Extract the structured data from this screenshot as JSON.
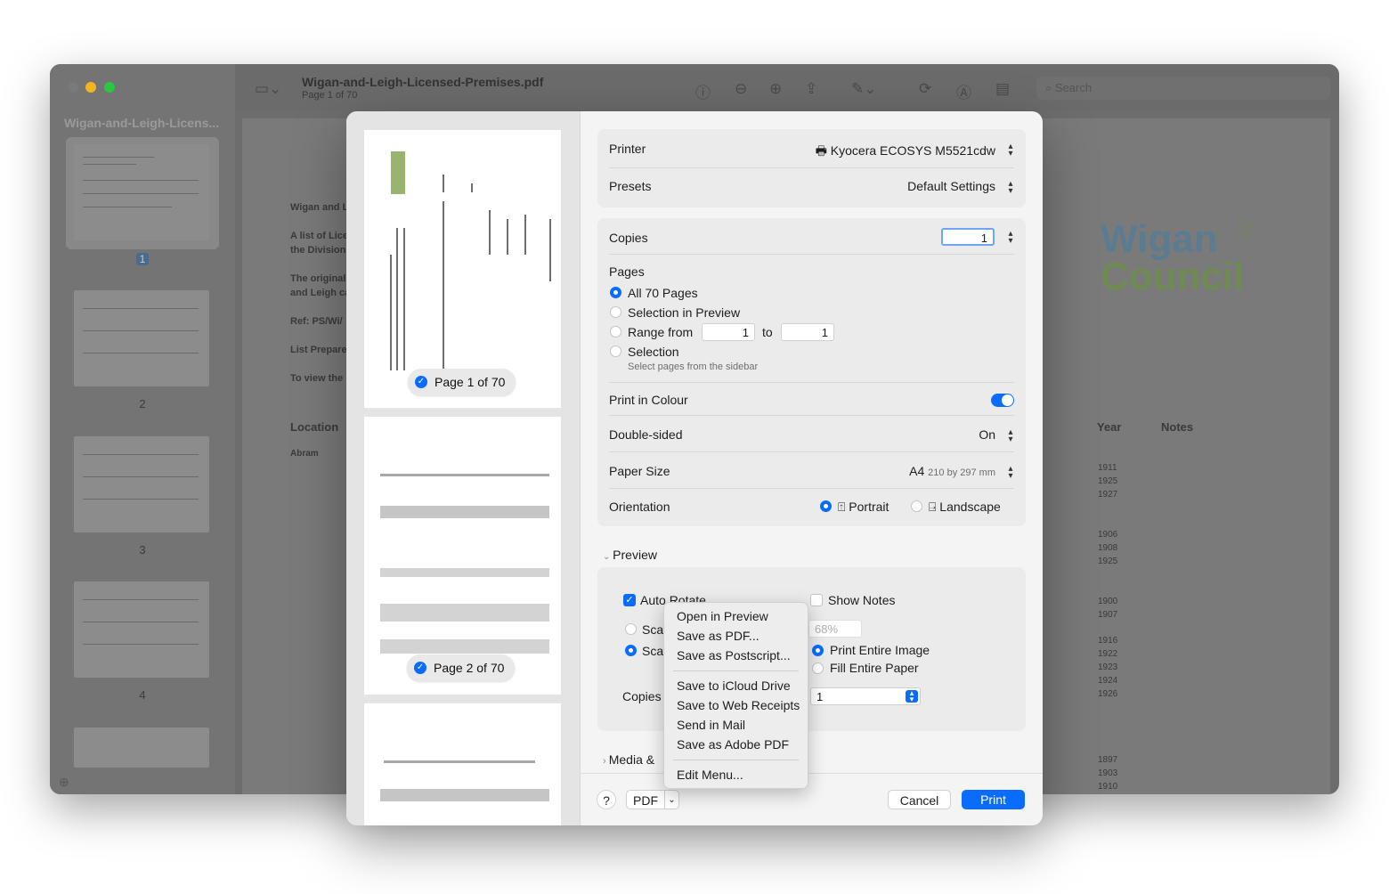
{
  "window": {
    "doc_title": "Wigan-and-Leigh-Licensed-Premises.pdf",
    "doc_subtitle": "Page 1 of 70",
    "search_placeholder": "Search",
    "sidebar_title": "Wigan-and-Leigh-Licens...",
    "thumbnail_numbers": [
      "1",
      "2",
      "3",
      "4"
    ]
  },
  "document": {
    "lines": [
      "Wigan and L",
      "A list of Lice",
      "the Division",
      "The original",
      "and Leigh ca",
      "Ref: PS/Wi/",
      "List Prepare",
      "To view the"
    ],
    "location_header": "Location",
    "first_location": "Abram",
    "year_header": "Year",
    "notes_header": "Notes",
    "years_group1": [
      "1911",
      "1925",
      "1927"
    ],
    "years_group2": [
      "1906",
      "1908",
      "1925"
    ],
    "years_group3": [
      "1900",
      "1907"
    ],
    "years_group4": [
      "1916",
      "1922",
      "1923",
      "1924",
      "1926"
    ],
    "years_group5": [
      "1897",
      "1903",
      "1910"
    ],
    "logo_line1": "Wigan",
    "logo_line2": "Council"
  },
  "dialog": {
    "preview_badges": [
      "Page 1 of 70",
      "Page 2 of 70"
    ],
    "printer_label": "Printer",
    "printer_value": "Kyocera ECOSYS M5521cdw",
    "presets_label": "Presets",
    "presets_value": "Default Settings",
    "copies_label": "Copies",
    "copies_value": "1",
    "pages_label": "Pages",
    "pages_all": "All 70 Pages",
    "pages_selection_preview": "Selection in Preview",
    "pages_range": "Range from",
    "range_from": "1",
    "range_to_label": "to",
    "range_to": "1",
    "pages_selection": "Selection",
    "pages_selection_note": "Select pages from the sidebar",
    "colour_label": "Print in Colour",
    "colour_on": true,
    "double_label": "Double-sided",
    "double_value": "On",
    "paper_label": "Paper Size",
    "paper_value": "A4",
    "paper_dims": "210 by 297 mm",
    "orientation_label": "Orientation",
    "orientation_portrait": "Portrait",
    "orientation_landscape": "Landscape",
    "preview_section": "Preview",
    "auto_rotate": "Auto Rotate",
    "show_notes": "Show Notes",
    "scale_a": "Scal",
    "scale_b": "Scal",
    "scale_percent": "68%",
    "print_entire": "Print Entire Image",
    "fill_paper": "Fill Entire Paper",
    "copies_per_page_label": "Copies",
    "copies_per_page_value": "1",
    "media_section": "Media &",
    "help": "?",
    "pdf_button": "PDF",
    "cancel": "Cancel",
    "print": "Print"
  },
  "pdf_menu": {
    "items_a": [
      "Open in Preview",
      "Save as PDF...",
      "Save as Postscript..."
    ],
    "items_b": [
      "Save to iCloud Drive",
      "Save to Web Receipts",
      "Send in Mail",
      "Save as Adobe PDF"
    ],
    "items_c": [
      "Edit Menu..."
    ]
  },
  "colors": {
    "accent": "#0a6cff",
    "close": "#6d6d6d",
    "minimize": "#f2b522",
    "zoom": "#28c840"
  }
}
